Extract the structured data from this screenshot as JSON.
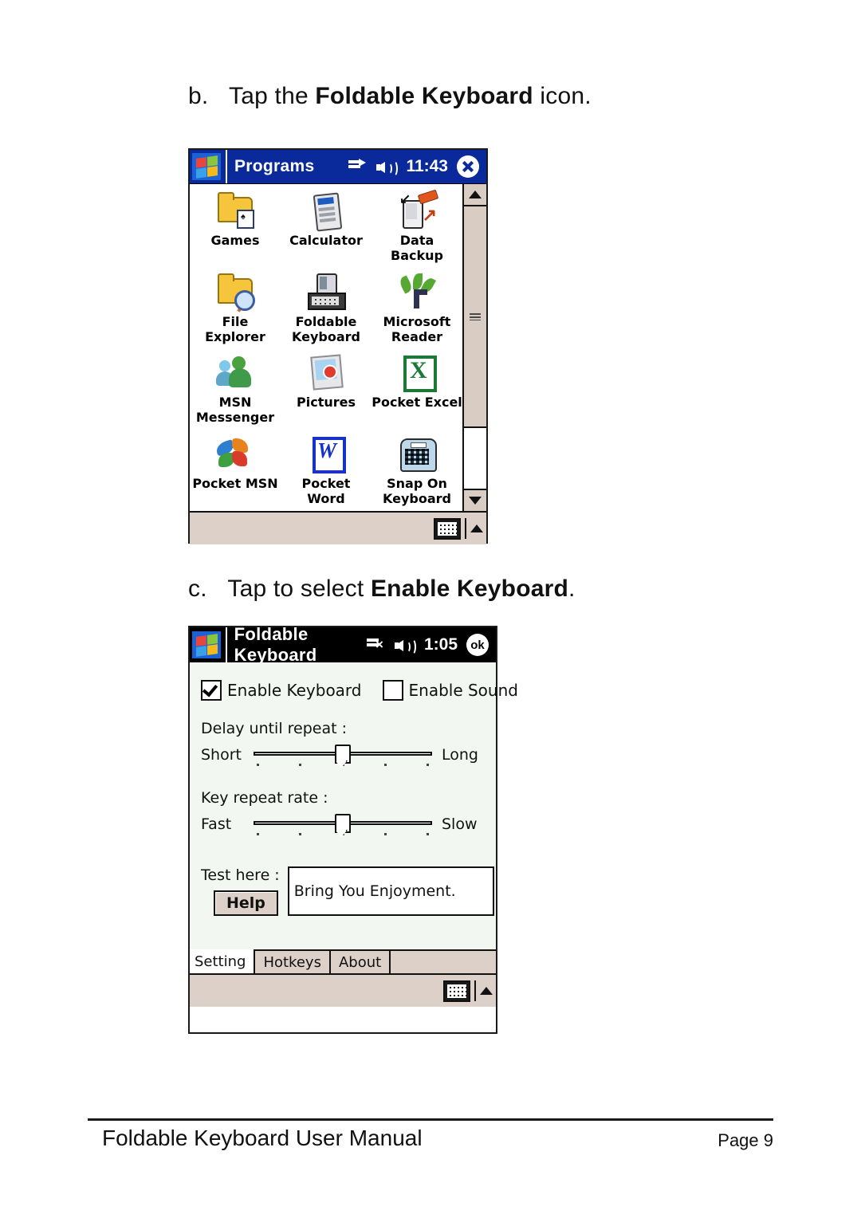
{
  "document": {
    "steps": [
      {
        "letter": "b.",
        "text_before": "Tap the ",
        "bold": "Foldable Keyboard",
        "text_after": " icon."
      },
      {
        "letter": "c.",
        "text_before": "Tap to select ",
        "bold": "Enable Keyboard",
        "text_after": "."
      }
    ],
    "footer": {
      "title": "Foldable Keyboard User Manual",
      "page": "Page 9"
    }
  },
  "programs_screen": {
    "titlebar": {
      "start_icon": "windows-logo-icon",
      "title": "Programs",
      "connectivity_icon": "connectivity-icon",
      "volume_icon": "speaker-icon",
      "time": "11:43",
      "close_icon": "close-icon"
    },
    "icons": [
      {
        "label": "Games",
        "glyph": "games-folder-icon"
      },
      {
        "label": "Calculator",
        "glyph": "calculator-icon"
      },
      {
        "label": "Data Backup",
        "glyph": "data-backup-icon"
      },
      {
        "label": "File Explorer",
        "glyph": "file-explorer-icon"
      },
      {
        "label": "Foldable\nKeyboard",
        "glyph": "foldable-keyboard-icon"
      },
      {
        "label": "Microsoft\nReader",
        "glyph": "microsoft-reader-icon"
      },
      {
        "label": "MSN\nMessenger",
        "glyph": "msn-messenger-icon"
      },
      {
        "label": "Pictures",
        "glyph": "pictures-icon"
      },
      {
        "label": "Pocket Excel",
        "glyph": "pocket-excel-icon"
      },
      {
        "label": "Pocket MSN",
        "glyph": "pocket-msn-icon"
      },
      {
        "label": "Pocket\nWord",
        "glyph": "pocket-word-icon"
      },
      {
        "label": "Snap On\nKeyboard",
        "glyph": "snap-on-keyboard-icon"
      }
    ],
    "scrollbar": {
      "up_icon": "scroll-up-icon",
      "down_icon": "scroll-down-icon",
      "grip_icon": "scroll-thumb-grip-icon"
    },
    "taskbar": {
      "sip_icon": "soft-input-panel-keyboard-icon",
      "sip_chevron_icon": "sip-selector-up-icon"
    },
    "colors": {
      "titlebar": "#0a2a9c",
      "taskbar": "#ddd0c8",
      "body": "#ffffff"
    }
  },
  "foldable_screen": {
    "titlebar": {
      "start_icon": "windows-logo-icon",
      "title": "Foldable Keyboard",
      "connectivity_icon": "connectivity-disconnected-icon",
      "volume_icon": "speaker-icon",
      "time": "1:05",
      "ok_label": "ok"
    },
    "checkboxes": [
      {
        "label": "Enable Keyboard",
        "checked": true
      },
      {
        "label": "Enable Sound",
        "checked": false
      }
    ],
    "sliders": [
      {
        "title": "Delay until repeat :",
        "left_label": "Short",
        "right_label": "Long",
        "value": 3,
        "min": 1,
        "max": 5,
        "tick_count": 5
      },
      {
        "title": "Key repeat rate :",
        "left_label": "Fast",
        "right_label": "Slow",
        "value": 3,
        "min": 1,
        "max": 5,
        "tick_count": 5
      }
    ],
    "test_area": {
      "label": "Test here :",
      "help_label": "Help",
      "input_value": "Bring You Enjoyment.",
      "input_placeholder": ""
    },
    "tabs": [
      {
        "label": "Setting",
        "active": true
      },
      {
        "label": "Hotkeys",
        "active": false
      },
      {
        "label": "About",
        "active": false
      }
    ],
    "taskbar": {
      "sip_icon": "soft-input-panel-keyboard-icon",
      "sip_chevron_icon": "sip-selector-up-icon"
    },
    "colors": {
      "titlebar": "#000000",
      "body": "#f3f7f1",
      "taskbar": "#ddd0c8",
      "button_face": "#ddd0c8"
    }
  }
}
